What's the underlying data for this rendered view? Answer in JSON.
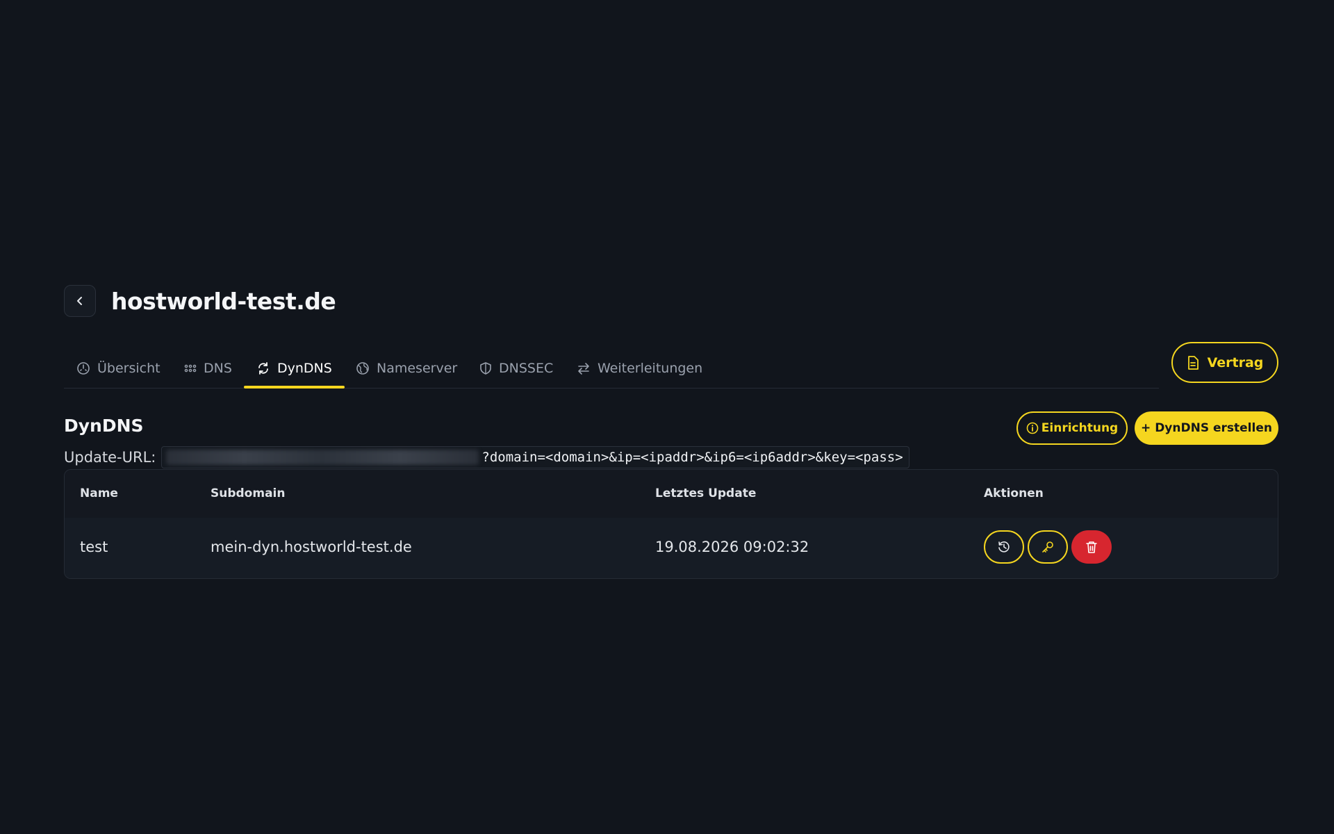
{
  "header": {
    "title": "hostworld-test.de"
  },
  "tabs": [
    {
      "label": "Übersicht",
      "icon": "gauge-icon"
    },
    {
      "label": "DNS",
      "icon": "grid-dots-icon"
    },
    {
      "label": "DynDNS",
      "icon": "refresh-icon",
      "active": true
    },
    {
      "label": "Nameserver",
      "icon": "globe-icon"
    },
    {
      "label": "DNSSEC",
      "icon": "shield-icon"
    },
    {
      "label": "Weiterleitungen",
      "icon": "arrows-exchange-icon"
    }
  ],
  "contract_button": {
    "label": "Vertrag"
  },
  "section": {
    "title": "DynDNS",
    "setup_button": "Einrichtung",
    "create_button": "+ DynDNS erstellen",
    "update_url_label": "Update-URL:",
    "update_url_query": "?domain=<domain>&ip=<ipaddr>&ip6=<ip6addr>&key=<pass>"
  },
  "table": {
    "columns": [
      "Name",
      "Subdomain",
      "Letztes Update",
      "Aktionen"
    ],
    "rows": [
      {
        "name": "test",
        "subdomain": "mein-dyn.hostworld-test.de",
        "last_update": "19.08.2026 09:02:32"
      }
    ]
  },
  "colors": {
    "accent": "#f5d61f",
    "danger": "#d7262f",
    "background": "#11151c"
  }
}
